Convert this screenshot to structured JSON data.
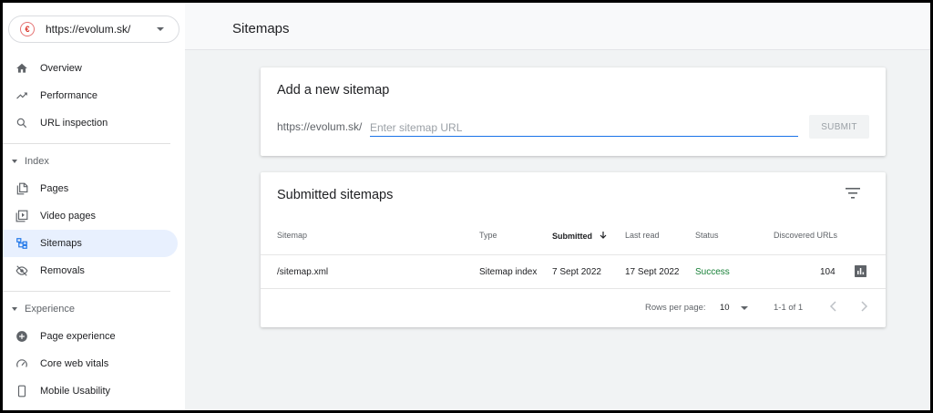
{
  "property": {
    "url": "https://evolum.sk/",
    "logo_letter": "€"
  },
  "nav": {
    "overview": "Overview",
    "performance": "Performance",
    "url_inspection": "URL inspection",
    "index_section": "Index",
    "pages": "Pages",
    "video_pages": "Video pages",
    "sitemaps": "Sitemaps",
    "removals": "Removals",
    "experience_section": "Experience",
    "page_experience": "Page experience",
    "core_web_vitals": "Core web vitals",
    "mobile_usability": "Mobile Usability",
    "active_item": "Sitemaps"
  },
  "header": {
    "title": "Sitemaps"
  },
  "add_sitemap": {
    "title": "Add a new sitemap",
    "prefix": "https://evolum.sk/",
    "input_value": "",
    "placeholder": "Enter sitemap URL",
    "submit_label": "SUBMIT"
  },
  "submitted": {
    "title": "Submitted sitemaps",
    "columns": [
      "Sitemap",
      "Type",
      "Submitted",
      "Last read",
      "Status",
      "Discovered URLs"
    ],
    "sorted_column": "Submitted",
    "rows": [
      {
        "sitemap": "/sitemap.xml",
        "type": "Sitemap index",
        "submitted": "7 Sept 2022",
        "last_read": "17 Sept 2022",
        "status": "Success",
        "discovered_urls": "104"
      }
    ],
    "pagination": {
      "rows_per_page_label": "Rows per page:",
      "rows_per_page": "10",
      "range": "1-1 of 1"
    }
  },
  "colors": {
    "accent": "#1a73e8",
    "active_nav_bg": "#e8f0fe",
    "success": "#188038"
  }
}
